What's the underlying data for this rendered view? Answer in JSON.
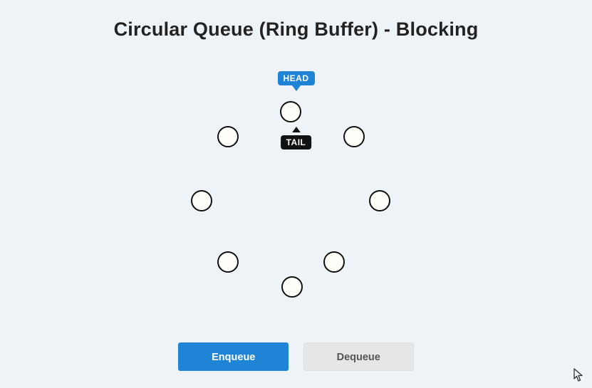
{
  "title": "Circular Queue (Ring Buffer) - Blocking",
  "pointers": {
    "head_label": "HEAD",
    "tail_label": "TAIL",
    "head_index": 0,
    "tail_index": 0
  },
  "ring": {
    "capacity": 8,
    "slots": [
      {
        "index": 0,
        "value": null
      },
      {
        "index": 1,
        "value": null
      },
      {
        "index": 2,
        "value": null
      },
      {
        "index": 3,
        "value": null
      },
      {
        "index": 4,
        "value": null
      },
      {
        "index": 5,
        "value": null
      },
      {
        "index": 6,
        "value": null
      },
      {
        "index": 7,
        "value": null
      }
    ]
  },
  "controls": {
    "enqueue_label": "Enqueue",
    "dequeue_label": "Dequeue"
  }
}
